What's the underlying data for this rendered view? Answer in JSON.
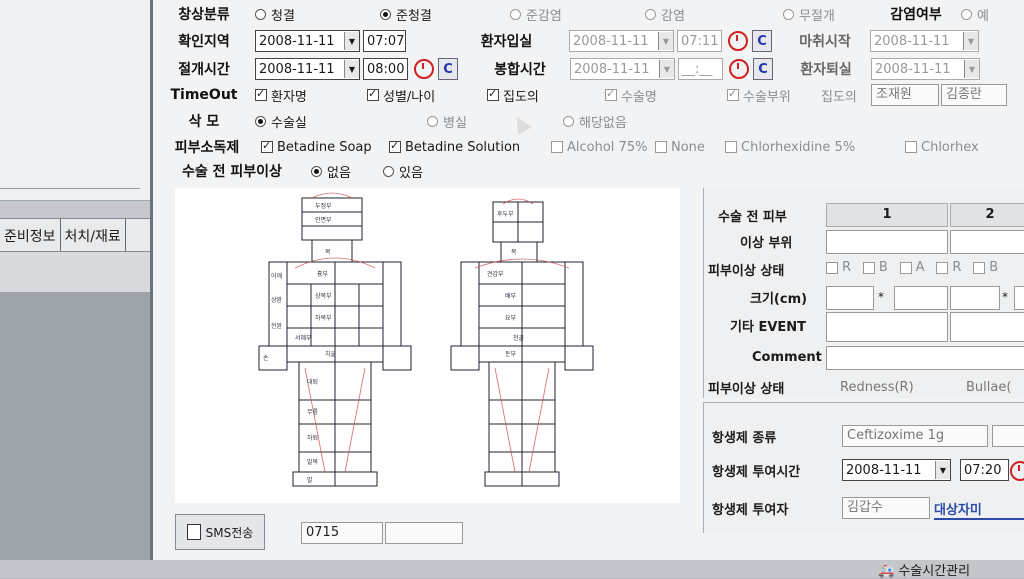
{
  "left_panel": {
    "tabs": [
      "준비정보",
      "처치/재료"
    ]
  },
  "form": {
    "wound_class": {
      "label": "창상분류",
      "options": [
        "청결",
        "준청결",
        "준감염",
        "감염",
        "무절개"
      ],
      "selected": 1
    },
    "infection": {
      "label": "감염여부",
      "option": "예"
    },
    "confirm_area": {
      "label": "확인지역",
      "date": "2008-11-11",
      "time": "07:07"
    },
    "incision_time": {
      "label": "절개시간",
      "date": "2008-11-11",
      "time": "08:00",
      "c_label": "C"
    },
    "patient_in": {
      "label": "환자입실",
      "date": "2008-11-11",
      "time": "07:11",
      "c_label": "C"
    },
    "suture_time": {
      "label": "봉합시간",
      "date": "2008-11-11",
      "time": "__:__",
      "c_label": "C"
    },
    "anesthesia_start": {
      "label": "마취시작",
      "date": "2008-11-11"
    },
    "patient_out": {
      "label": "환자퇴실",
      "date": "2008-11-11"
    },
    "timeout": {
      "label": "TimeOut",
      "items": [
        "환자명",
        "성별/나이",
        "집도의",
        "수술명",
        "수술부위"
      ],
      "surgeon_label": "집도의",
      "staff": [
        "조재원",
        "김종란"
      ]
    },
    "shaving": {
      "label": "삭 모",
      "options": [
        "수술실",
        "병실",
        "해당없음"
      ],
      "selected": 0
    },
    "disinfectant": {
      "label": "피부소독제",
      "items": [
        {
          "name": "Betadine Soap",
          "checked": true
        },
        {
          "name": "Betadine Solution",
          "checked": true
        },
        {
          "name": "Alcohol 75%",
          "checked": false
        },
        {
          "name": "None",
          "checked": false
        },
        {
          "name": "Chlorhexidine 5%",
          "checked": false
        },
        {
          "name": "Chlorhex",
          "checked": false
        }
      ]
    },
    "preop_skin": {
      "label": "수술 전 피부이상",
      "options": [
        "없음",
        "있음"
      ],
      "selected": 0
    }
  },
  "skin_panel": {
    "header_label": "수술 전 피부",
    "columns": [
      "1",
      "2"
    ],
    "site_label": "이상 부위",
    "state_label": "피부이상 상태",
    "state_opts": [
      "R",
      "B",
      "A",
      "R",
      "B"
    ],
    "size_label": "크기(cm)",
    "times": "*",
    "event_label": "기타 EVENT",
    "comment_label": "Comment",
    "legend_label": "피부이상 상태",
    "legend_values": [
      "Redness(R)",
      "Bullae("
    ]
  },
  "antibiotic": {
    "type_label": "항생제 종류",
    "type_value": "Ceftizoxime 1g",
    "time_label": "항생제 투여시간",
    "date": "2008-11-11",
    "time": "07:20",
    "giver_label": "항생제 투여자",
    "giver": "김갑수",
    "target_label": "대상자미"
  },
  "bottom": {
    "sms_label": "SMS전송",
    "code": "0715",
    "surgery_time_link": "수술시간관리"
  },
  "body_labels": {
    "head": [
      "두정부",
      "안면부",
      "목"
    ],
    "back_head": [
      "후두부",
      "목"
    ],
    "front_torso": [
      "흉부",
      "상복부",
      "하복부",
      "서혜부",
      "치골"
    ],
    "back_torso": [
      "견갑부",
      "배부",
      "요부",
      "천골",
      "둔부"
    ],
    "limbs": [
      "어깨",
      "상완",
      "전완",
      "손",
      "대퇴",
      "무릎",
      "하퇴",
      "발목",
      "발"
    ]
  }
}
